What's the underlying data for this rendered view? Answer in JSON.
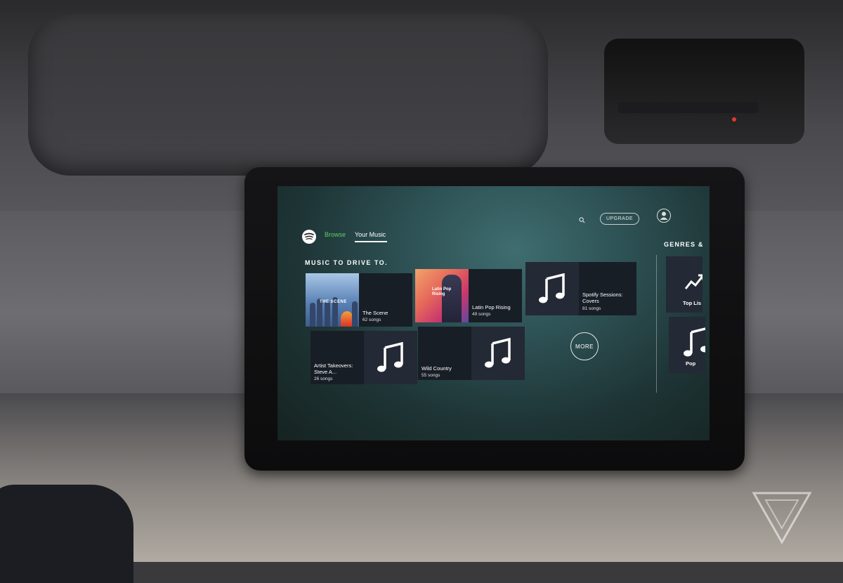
{
  "app": {
    "tabs": [
      {
        "label": "Browse",
        "active": false
      },
      {
        "label": "Your Music",
        "active": true
      }
    ],
    "upgrade_label": "UPGRADE",
    "icons": {
      "logo": "spotify-logo-icon",
      "search": "search-icon",
      "profile": "user-icon"
    }
  },
  "section": {
    "title": "MUSIC TO DRIVE TO.",
    "playlists": [
      {
        "name": "The Scene",
        "count": "62 songs",
        "art_label": "THE SCENE"
      },
      {
        "name": "Latin Pop Rising",
        "count": "49 songs",
        "art_label": "Latin Pop Rising"
      },
      {
        "name": "Spotify Sessions: Covers",
        "count": "81 songs"
      },
      {
        "name": "Artist Takeovers: Steve A...",
        "count": "26 songs"
      },
      {
        "name": "Wild Country",
        "count": "55 songs"
      }
    ],
    "more_label": "MORE"
  },
  "genres": {
    "title": "GENRES &",
    "items": [
      {
        "name": "Top Lis"
      },
      {
        "name": "Pop"
      }
    ]
  },
  "colors": {
    "accent_green": "#5fcf5f",
    "card_bg": "#232935"
  }
}
